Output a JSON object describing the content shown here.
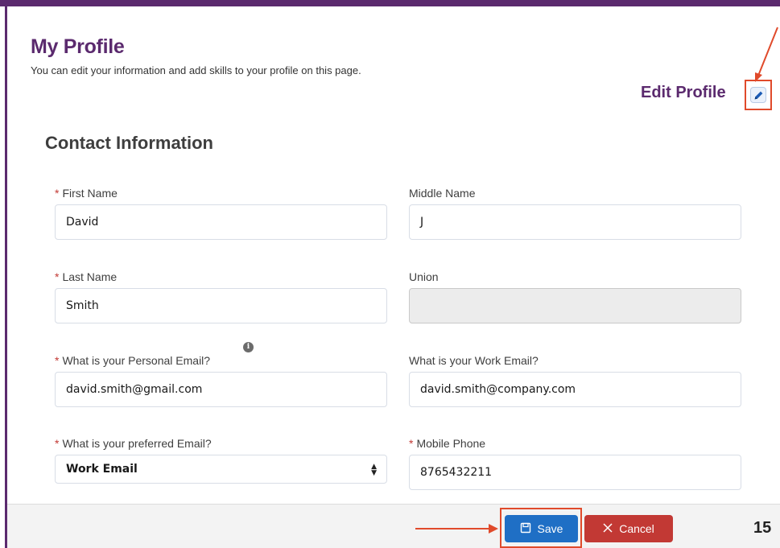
{
  "header": {
    "title": "My Profile",
    "subtitle": "You can edit your information and add skills to your profile on this page.",
    "edit_profile_label": "Edit Profile"
  },
  "section": {
    "title": "Contact Information"
  },
  "fields": {
    "first_name": {
      "label": "First Name",
      "value": "David",
      "required": true
    },
    "middle_name": {
      "label": "Middle Name",
      "value": "J",
      "required": false
    },
    "last_name": {
      "label": "Last Name",
      "value": "Smith",
      "required": true
    },
    "union": {
      "label": "Union",
      "value": "",
      "required": false,
      "disabled": true
    },
    "personal_email": {
      "label": "What is your Personal Email?",
      "value": "david.smith@gmail.com",
      "required": true
    },
    "work_email": {
      "label": "What is your Work Email?",
      "value": "david.smith@company.com",
      "required": false
    },
    "preferred_email": {
      "label": "What is your preferred Email?",
      "value": "Work Email",
      "required": true
    },
    "mobile_phone": {
      "label": "Mobile Phone",
      "value": "8765432211",
      "required": true
    }
  },
  "required_marker": "*",
  "info_icon_glyph": "i",
  "footer": {
    "save_label": "Save",
    "cancel_label": "Cancel",
    "page_number": "15"
  },
  "colors": {
    "brand": "#5b2a6e",
    "save": "#1f6fc5",
    "cancel": "#c23934",
    "annotation": "#e04a2b"
  },
  "icons": [
    "pencil-icon",
    "info-icon",
    "save-icon",
    "close-icon",
    "select-arrows-icon"
  ]
}
